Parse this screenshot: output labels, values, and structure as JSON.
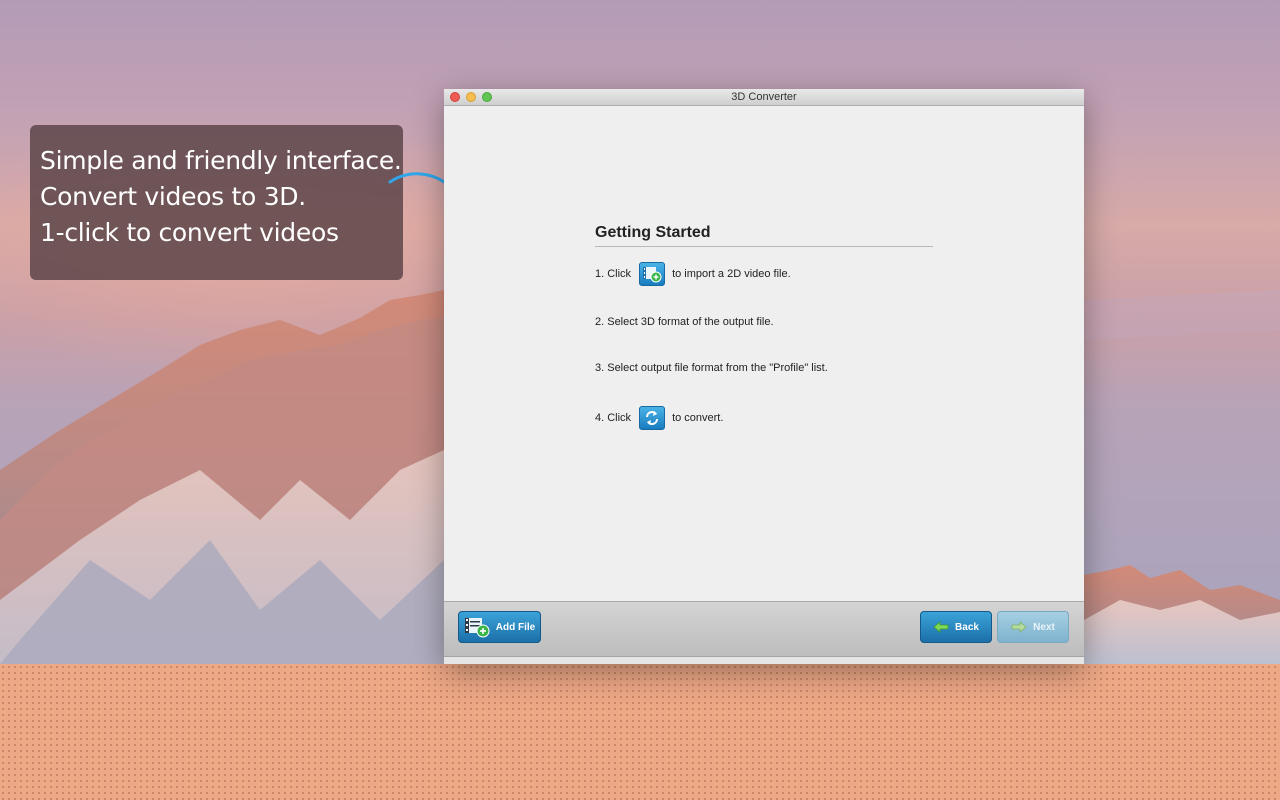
{
  "callout": {
    "lines": [
      "Simple and friendly interface.",
      "Convert videos to 3D.",
      "1-click to convert videos"
    ]
  },
  "window": {
    "title": "3D Converter"
  },
  "getting_started": {
    "heading": "Getting Started",
    "step1_prefix": "1. Click",
    "step1_suffix": "to import a 2D video file.",
    "step2": "2. Select 3D format of the output file.",
    "step3": "3. Select output file format from the \"Profile\" list.",
    "step4_prefix": "4. Click",
    "step4_suffix": "to convert."
  },
  "footer": {
    "add_file_label": "Add File",
    "back_label": "Back",
    "next_label": "Next"
  },
  "icons": {
    "add_video": "film-add-icon",
    "convert": "convert-icon",
    "back": "arrow-left-icon",
    "next": "arrow-right-icon"
  },
  "colors": {
    "accent_blue": "#1d6fa9",
    "callout_bg": "#584246"
  }
}
